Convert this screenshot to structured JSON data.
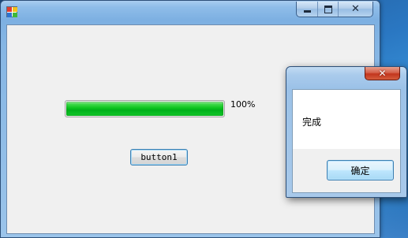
{
  "main_window": {
    "title": "",
    "icon": "app-icon",
    "buttons": {
      "minimize": "minimize-icon",
      "maximize": "maximize-icon",
      "close": "close-icon",
      "close_glyph": "✕"
    }
  },
  "form": {
    "progress": {
      "value": 100,
      "text": "100%",
      "color": "#0bc41e"
    },
    "button1_label": "button1"
  },
  "message_box": {
    "close_glyph": "✕",
    "message": "完成",
    "ok_label": "确定",
    "close_color": "#c2351d"
  }
}
